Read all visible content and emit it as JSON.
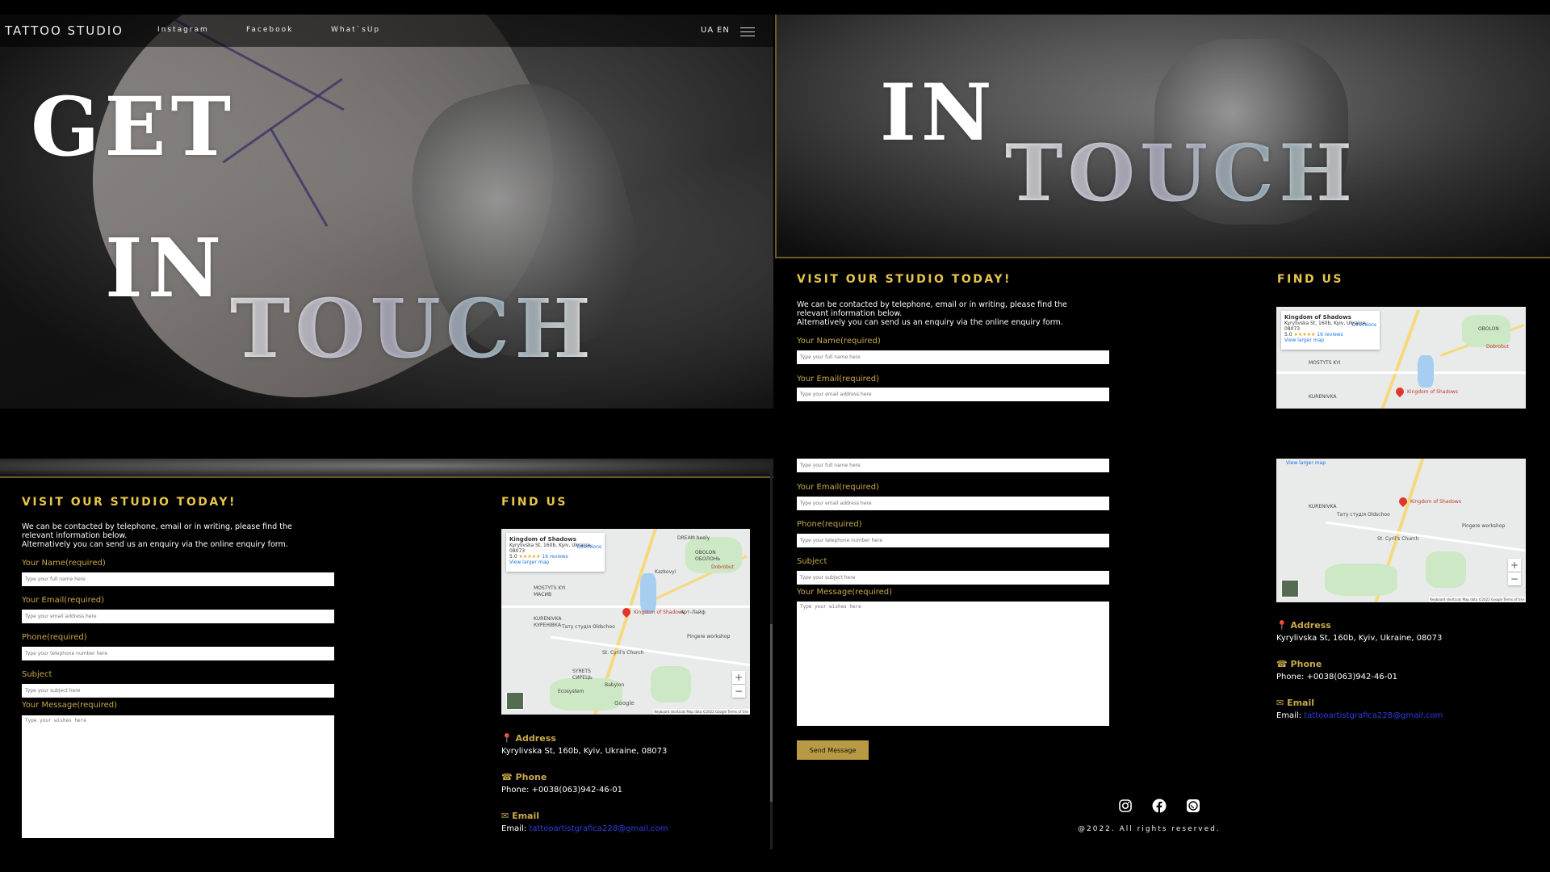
{
  "site": {
    "brand": "TATTOO STUDIO",
    "nav": [
      "Instagram",
      "Facebook",
      "What`sUp"
    ],
    "lang": {
      "ua": "UA",
      "en": "EN"
    }
  },
  "hero": {
    "word1": "GET",
    "word2": "IN",
    "word3": "TOUCH"
  },
  "contact": {
    "heading": "VISIT OUR STUDIO TODAY!",
    "intro_line1": "We can be contacted by telephone, email or in writing, please find the",
    "intro_line2": "relevant information below.",
    "intro_line3": "Alternatively you can send us an enquiry via the online enquiry form.",
    "name_label": "Your Name(required)",
    "name_placeholder": "Type your full name here",
    "email_label": "Your Email(required)",
    "email_placeholder": "Type your email address here",
    "phone_label": "Phone(required)",
    "phone_placeholder": "Type your telephone number here",
    "subject_label": "Subject",
    "subject_placeholder": "Type your subject here",
    "message_label": "Your Message(required)",
    "message_placeholder": "Type your wishes here",
    "send_label": "Send Message"
  },
  "find_us": {
    "heading": "FIND US",
    "map": {
      "place_name": "Kingdom of Shadows",
      "place_address": "Kyrylivska St, 160b, Kyiv, Ukraine,",
      "place_postcode": "08073",
      "rating": "5.0",
      "stars": "★★★★★",
      "reviews": "16 reviews",
      "directions": "Directions",
      "view_larger": "View larger map",
      "pin_label": "Kingdom of Shadows",
      "poi": [
        "OBOLON",
        "ОБОЛОНЬ",
        "MOSTYTS KYI",
        "МАСИВ",
        "KURENIVKA",
        "КУРЕНІВКА",
        "SYRETS",
        "СИРЕЦЬ",
        "Kazkovyi",
        "Арт-Лайф",
        "Pingere workshop",
        "St. Cyril's Church",
        "Dobrobut",
        "DREAM beely",
        "Тату студія Oldschoo",
        "Babylon",
        "Ecosystem"
      ],
      "zoom_in": "+",
      "zoom_out": "−",
      "footer": "Keyboard shortcuts  Map data ©2022 Google  Terms of Use",
      "google": "Google"
    },
    "address_title": "Address",
    "address_text": "Kyrylivska St, 160b, Kyiv, Ukraine, 08073",
    "phone_title": "Phone",
    "phone_text": "Phone: +0038(063)942-46-01",
    "email_title": "Email",
    "email_prefix": "Email:",
    "email_link": "tattooartistgrafica228@gmail.com"
  },
  "footer": {
    "copyright": "@2022. All rights reserved.",
    "icons": [
      "instagram-icon",
      "facebook-icon",
      "whatsapp-icon"
    ]
  },
  "colors": {
    "gold": "#e7c64a",
    "label_gold": "#c8a94a",
    "button": "#b89a45",
    "link": "#2b3fe0"
  }
}
